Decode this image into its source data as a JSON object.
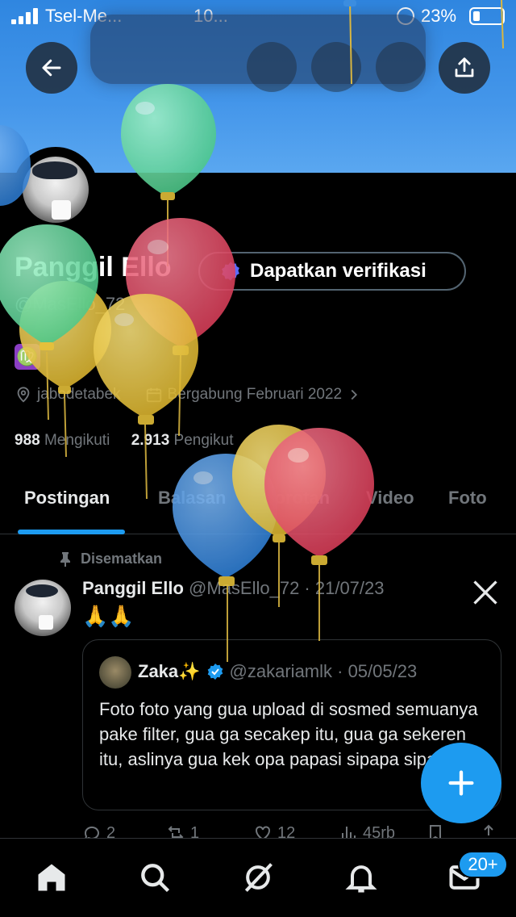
{
  "status_bar": {
    "carrier": "Tsel-Me...",
    "time": "10...",
    "battery": "23%"
  },
  "profile": {
    "name": "Panggil Ello",
    "handle": "@MasEllo_72",
    "verify_button": "Dapatkan verifikasi",
    "zodiac": "♍",
    "location": "jabodetabek",
    "joined": "Bergabung Februari 2022",
    "following_count": "988",
    "following_label": "Mengikuti",
    "followers_count": "2.913",
    "followers_label": "Pengikut"
  },
  "tabs": [
    {
      "label": "Postingan",
      "active": true
    },
    {
      "label": "Balasan"
    },
    {
      "label": "Sorotan"
    },
    {
      "label": "Video"
    },
    {
      "label": "Foto"
    }
  ],
  "post": {
    "pinned_label": "Disematkan",
    "author_name": "Panggil Ello",
    "author_meta": "@MasEllo_72 · 21/07/23",
    "text": "🙏🙏",
    "quote": {
      "name": "Zaka✨",
      "meta": "@zakariamlk · 05/05/23",
      "text": "Foto foto yang gua upload di sosmed semuanya pake filter, gua ga secakep itu, gua ga sekeren itu, aslinya gua kek opa papasi sipapa sipaga."
    },
    "actions": {
      "replies": "2",
      "reposts": "1",
      "likes": "12",
      "views": "45rb"
    }
  },
  "nav": {
    "dm_badge": "20+"
  },
  "colors": {
    "accent": "#1d9bf0",
    "banner": "#3f91e6",
    "balloon_green": "#5ed49a",
    "balloon_red": "#e04a62",
    "balloon_yellow": "#e6c43c",
    "balloon_blue": "#3b8de0"
  }
}
